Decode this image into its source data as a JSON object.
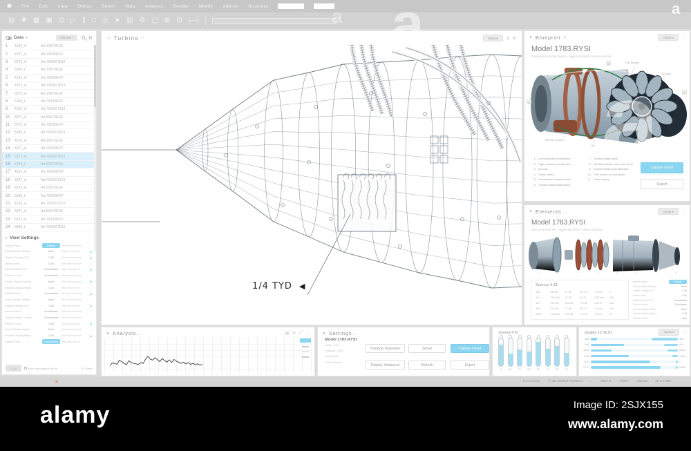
{
  "menu": {
    "items": [
      "File",
      "Edit",
      "View",
      "Option",
      "Select",
      "Help",
      "Analysis",
      "Render",
      "Modify",
      "Add-on",
      "Structure"
    ]
  },
  "toolbar": {
    "icons": [
      {
        "name": "select-icon",
        "glyph": "▤"
      },
      {
        "name": "move-icon",
        "glyph": "✚"
      },
      {
        "name": "grid-icon",
        "glyph": "▦"
      },
      {
        "name": "save-icon",
        "glyph": "▣"
      },
      {
        "name": "measure-icon",
        "glyph": "⊡"
      },
      {
        "name": "play-icon",
        "glyph": "▷"
      },
      {
        "name": "pause-icon",
        "glyph": "∥"
      },
      {
        "name": "stop-icon",
        "glyph": "□"
      },
      {
        "name": "record-icon",
        "glyph": "◎"
      },
      {
        "name": "cursor-icon",
        "glyph": "➤"
      },
      {
        "name": "layers-icon",
        "glyph": "▥"
      },
      {
        "name": "settings-icon",
        "glyph": "⚙"
      },
      {
        "name": "box-icon",
        "glyph": "▢"
      },
      {
        "name": "add-box-icon",
        "glyph": "⊞"
      },
      {
        "name": "remove-box-icon",
        "glyph": "⊟"
      },
      {
        "name": "ruler-icon",
        "glyph": "|—|"
      }
    ]
  },
  "viewport": {
    "title": "Turbine",
    "title_suffix": "–",
    "options_label": "Options",
    "annotation": "1/4  TYD",
    "arrow_glyph": "◀"
  },
  "data_panel": {
    "title": "Data",
    "add_button": "Add row +",
    "selected": [
      15,
      16
    ],
    "parts_cycle": [
      "4126_A",
      "4257_A",
      "6373_A",
      "5268_L"
    ],
    "articles": [
      "Art.12679GSK",
      "Art.73039907F",
      "Art.725687361J",
      "Art.12679GSK",
      "Art.73039907F",
      "Art.725687361J",
      "Art.12679GSK",
      "Art.73039907F",
      "Art.725687361J",
      "Art.52679GSK",
      "Art.73039907F",
      "Art.725687361J",
      "Art.52679GSK",
      "Art.73039907F",
      "Art.725687361J",
      "Art.52679GSK",
      "Art.73039907F",
      "Art.725687361J",
      "Art.52679GSK",
      "Art.73039907F",
      "Art.725687361J",
      "Art.52679GSK",
      "Art.73039907F",
      "Art.725687361J"
    ],
    "view_settings": {
      "title": "View Settings",
      "descs": [
        "Wire reference sys",
        "High structure thr",
        "Instrument describ"
      ],
      "rows": [
        {
          "label": "Display Parts",
          "value": "Default",
          "accent": true,
          "star": false
        },
        {
          "label": "Show Details Visibility",
          "value": "None",
          "accent": false,
          "star": true
        },
        {
          "label": "Graphic Display XYZ",
          "value": "0.48",
          "accent": false,
          "star": true
        },
        {
          "label": "Vector Level",
          "value": "0.48",
          "accent": false,
          "star": false
        },
        {
          "label": "Infinite Details XYZ",
          "value": "Coordinates",
          "accent": false,
          "star": true
        },
        {
          "label": "Preform Level",
          "value": "Coordinates",
          "accent": false,
          "star": false
        },
        {
          "label": "Arrows Display Interim",
          "value": "None",
          "accent": false,
          "star": true
        },
        {
          "label": "Smooth Display Adjust",
          "value": "0.48",
          "accent": false,
          "star": false
        },
        {
          "label": "Defined Parts",
          "value": "Coordinates",
          "accent": false,
          "star": true
        },
        {
          "label": "Show Details Visibility",
          "value": "None",
          "accent": false,
          "star": false
        },
        {
          "label": "Graphic Display XYZ",
          "value": "0.48",
          "accent": false,
          "star": true
        },
        {
          "label": "Vector Level 2",
          "value": "Coordinates",
          "accent": false,
          "star": false
        },
        {
          "label": "Display Details Counter",
          "value": "Coordinates",
          "accent": false,
          "star": false
        },
        {
          "label": "Preform Level",
          "value": "0.48",
          "accent": false,
          "star": true
        },
        {
          "label": "Arrow Display Interim",
          "value": "None",
          "accent": false,
          "star": false
        },
        {
          "label": "Smooth Display Adjust",
          "value": "0.48",
          "accent": false,
          "star": true
        },
        {
          "label": "Default Parts",
          "value": "Coordinates",
          "accent": true,
          "star": false
        }
      ]
    },
    "footer": {
      "button": "1–24",
      "file": "New_mechanical.file.ps",
      "reset": "Reset"
    }
  },
  "blueprint": {
    "title": "Blueprint",
    "options_label": "Options",
    "model": "Model 1783.RYSI",
    "subtitle": "Powerplant turbofan layout – rigged elements overview section",
    "annotations": [
      "Fan blades",
      "Oil cells",
      "Mid fan support",
      "Oil"
    ],
    "chips": [
      "7",
      "5",
      "3"
    ],
    "legend": [
      "Low pressure compressor",
      "High pressure compressor",
      "Air seal",
      "Guide vanes",
      "Combustion chamber liner",
      "Turbine blade shaft switch",
      "Turbine blade airfoil",
      "Oil-wheel blade cover and dome",
      "Turbine blade snap diameter",
      "Fuel nozzle rot and stator",
      "Outer casing"
    ],
    "capture_button": "Capture mount",
    "export_button": "Export"
  },
  "elements": {
    "title": "Elements ..",
    "options_label": "Options",
    "model": "Model 1783.RYSI",
    "subtitle": "Parts and fields list – rigged elements / turbine selection",
    "ticks": [
      "1",
      "2",
      "3",
      "4",
      "5",
      "6",
      "7",
      "8"
    ],
    "sourcys": {
      "title": "Sourcys 4.91",
      "rows": [
        [
          "4AD",
          "164 dB",
          "17 dB",
          "111.33",
          "0.1 mm",
          "5"
        ],
        [
          "4A7",
          "1249 dB",
          "19 dB",
          "51.33",
          "0.81 mm",
          "44A"
        ],
        [
          "4IB",
          "154 dB",
          "164 dB",
          "717.43",
          "0.39 m",
          "46A"
        ],
        [
          "4AD",
          "164 dB",
          "17 dB",
          "111.33",
          "0.1 mm",
          "4A2"
        ],
        [
          "4WB",
          "1264 dB",
          "194 dB",
          "717.43",
          "0.4 mm",
          "4A"
        ]
      ]
    },
    "settings": [
      {
        "label": "Render profile",
        "value": "Default",
        "accent": true
      },
      {
        "label": "Show Details Visibility",
        "value": "None",
        "accent": false
      },
      {
        "label": "Graphic Display XYZ",
        "value": "0.48",
        "accent": false
      },
      {
        "label": "Vector Level",
        "value": "0.81",
        "accent": false
      },
      {
        "label": "Infinite Details XYZ",
        "value": "Coordinates",
        "accent": false
      },
      {
        "label": "Preform Level",
        "value": "Coordinates",
        "accent": false
      },
      {
        "label": "Arrows Display Interim",
        "value": "None",
        "accent": false
      },
      {
        "label": "Smooth Display Adjust",
        "value": "0.48",
        "accent": false
      },
      {
        "label": "Defined Parts",
        "value": "Auto",
        "accent": false
      }
    ]
  },
  "analysis": {
    "title": "Analysis..",
    "values": [
      30,
      42,
      40,
      36,
      55,
      48,
      40,
      34,
      52,
      44,
      40,
      38,
      35,
      44,
      40,
      58,
      72,
      60,
      55,
      66,
      58,
      48,
      62,
      54,
      46,
      56,
      44,
      58,
      50,
      46,
      40,
      46,
      38,
      44,
      36,
      40,
      34,
      38,
      32,
      36
    ]
  },
  "settings_panel": {
    "title": "Settings..",
    "model": "Model 1783.RYSI",
    "info": [
      "Audio: 74%",
      "Polyplay: 7684",
      "User Scale",
      "Smart Guides"
    ],
    "buttons": [
      {
        "label": "Tracking: Automatic",
        "accent": false
      },
      {
        "label": "Server",
        "accent": false
      },
      {
        "label": "Capture mount",
        "accent": true
      },
      {
        "label": "Display: Advanced",
        "accent": false
      },
      {
        "label": "Refresh",
        "accent": false
      },
      {
        "label": "Export",
        "accent": false
      }
    ]
  },
  "sovrea": {
    "title": "Sovrea 4.91",
    "tubes": [
      {
        "label": "A1",
        "fill": 78
      },
      {
        "label": "B4",
        "fill": 46
      },
      {
        "label": "C2",
        "fill": 60
      },
      {
        "label": "D8",
        "fill": 52
      },
      {
        "label": "E3",
        "fill": 88
      },
      {
        "label": "F6",
        "fill": 62
      },
      {
        "label": "G5",
        "fill": 72
      },
      {
        "label": "H2",
        "fill": 48
      }
    ]
  },
  "quality": {
    "title": "Quality 12.36.91",
    "options_label": "Options",
    "rows": [
      {
        "label": "4AN",
        "value": 7,
        "right_value": 30,
        "right_label": "4AN"
      },
      {
        "label": "AHL",
        "value": 38,
        "right_value": 16,
        "right_label": "AHL"
      },
      {
        "label": "ALD2",
        "value": 24,
        "right_value": 12,
        "right_label": "ALD2"
      },
      {
        "label": "U-Da",
        "value": 44,
        "right_value": 6,
        "right_label": "U-Da"
      },
      {
        "label": "LY-11",
        "value": 68,
        "right_value": 2,
        "right_label": "1"
      },
      {
        "label": "LV-71",
        "value": 80,
        "right_value": 2,
        "right_label": "MA39"
      }
    ]
  },
  "status_bar": {
    "items": [
      "● 4.0 ready",
      "✎ GK Medium Nucleus",
      "+",
      "3647 B",
      "HMX2",
      "160.28",
      "M: 2.7 GB"
    ]
  },
  "alamy": {
    "logo": "alamy",
    "image_id": "Image ID: 2SJX155",
    "url": "www.alamy.com",
    "watermark": "a"
  },
  "colors": {
    "accent": "#8ad5f0",
    "highlight_row": "#d9f0fa",
    "alamy_bar": "#000000",
    "red_mark": "#e2684f"
  }
}
